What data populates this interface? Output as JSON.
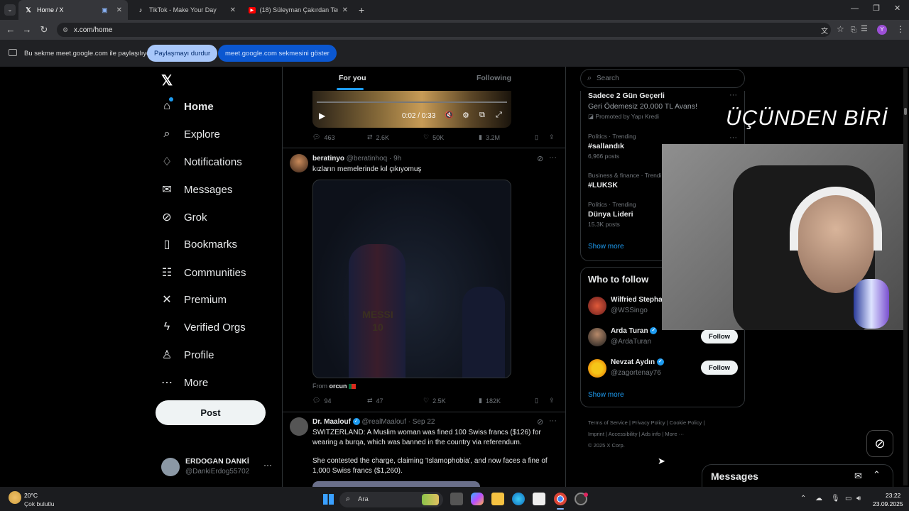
{
  "browser": {
    "tabs": [
      {
        "label": "Home / X",
        "active": true
      },
      {
        "label": "TikTok - Make Your Day",
        "active": false
      },
      {
        "label": "(18) Süleyman Çakırdan Temel F...",
        "active": false
      }
    ],
    "url": "x.com/home",
    "share_text": "Bu sekme meet.google.com ile paylaşılıyor",
    "stop_share": "Paylaşmayı durdur",
    "show_tab": "meet.google.com sekmesini göster"
  },
  "nav": {
    "items": [
      {
        "label": "Home",
        "icon": "home-icon"
      },
      {
        "label": "Explore",
        "icon": "search-icon"
      },
      {
        "label": "Notifications",
        "icon": "bell-icon"
      },
      {
        "label": "Messages",
        "icon": "envelope-icon"
      },
      {
        "label": "Grok",
        "icon": "grok-icon"
      },
      {
        "label": "Bookmarks",
        "icon": "bookmark-icon"
      },
      {
        "label": "Communities",
        "icon": "people-icon"
      },
      {
        "label": "Premium",
        "icon": "x-logo-icon"
      },
      {
        "label": "Verified Orgs",
        "icon": "lightning-icon"
      },
      {
        "label": "Profile",
        "icon": "person-icon"
      },
      {
        "label": "More",
        "icon": "more-circle-icon"
      }
    ],
    "post": "Post",
    "user_name": "ERDOGAN DANKİ",
    "user_handle": "@DankiErdog55702"
  },
  "feed": {
    "tab_foryou": "For you",
    "tab_following": "Following",
    "video_time": "0:02 / 0:33",
    "top_stats": {
      "replies": "463",
      "reposts": "2.6K",
      "likes": "50K",
      "views": "3.2M"
    },
    "post1": {
      "name": "beratinyo",
      "handle": "@beratinhoq · 9h",
      "text": "kızların memelerinde kıl çıkıyomuş",
      "from_label": "From",
      "from_user": "orcun",
      "stats": {
        "replies": "94",
        "reposts": "47",
        "likes": "2.5K",
        "views": "182K"
      },
      "image_text": "MESSI 10"
    },
    "post2": {
      "name": "Dr. Maalouf",
      "handle": "@realMaalouf · Sep 22",
      "text1": "SWITZERLAND: A Muslim woman was fined 100 Swiss francs ($126) for wearing a burqa, which was banned in the country via referendum.",
      "text2": "She contested the charge, claiming 'Islamophobia', and now faces a fine of 1,000 Swiss francs ($1,260)."
    }
  },
  "sidebar": {
    "search_placeholder": "Search",
    "ad": {
      "title": "Sadece 2 Gün Geçerli",
      "sub": "Geri Ödemesiz 20.000 TL Avans!",
      "promoted": "Promoted by Yapı Kredi"
    },
    "trends": [
      {
        "cat": "Politics · Trending",
        "name": "#sallandık",
        "posts": "6,966 posts"
      },
      {
        "cat": "Business & finance · Trending",
        "name": "#LUKSK",
        "posts": ""
      },
      {
        "cat": "Politics · Trending",
        "name": "Dünya Lideri",
        "posts": "15.3K posts"
      }
    ],
    "show_more": "Show more",
    "who_title": "Who to follow",
    "who": [
      {
        "name": "Wilfried Stephane",
        "handle": "@WSSingo",
        "follow": ""
      },
      {
        "name": "Arda Turan",
        "handle": "@ArdaTuran",
        "follow": "Follow"
      },
      {
        "name": "Nevzat Aydın",
        "handle": "@zagortenay76",
        "follow": "Follow"
      }
    ],
    "footer1": [
      "Terms of Service",
      "Privacy Policy",
      "Cookie Policy"
    ],
    "footer2": [
      "Imprint",
      "Accessibility",
      "Ads info",
      "More ···"
    ],
    "copyright": "© 2025 X Corp."
  },
  "overlay": {
    "caption": "ÜÇÜNDEN BİRİ"
  },
  "messages_drawer": "Messages",
  "taskbar": {
    "temp": "20°C",
    "weather": "Çok bulutlu",
    "search": "Ara",
    "time": "23:22",
    "date": "23.09.2025"
  }
}
